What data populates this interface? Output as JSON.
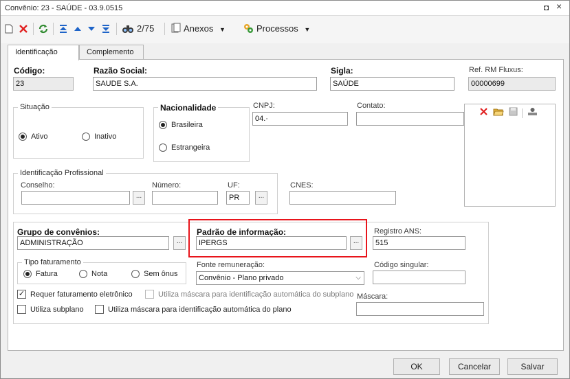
{
  "window": {
    "title": "Convênio: 23 - SAÚDE - 03.9.0515",
    "restore_glyph": "◘",
    "close_glyph": "×"
  },
  "toolbar": {
    "record_position": "2/75",
    "anexos_label": "Anexos",
    "processos_label": "Processos",
    "icons": [
      "new-icon",
      "delete-icon",
      "refresh-icon",
      "first-icon",
      "previous-icon",
      "next-icon",
      "last-icon",
      "find-icon",
      "attachments-icon",
      "processes-icon"
    ]
  },
  "tabs": [
    {
      "label": "Identificação",
      "active": true
    },
    {
      "label": "Complemento",
      "active": false
    }
  ],
  "form": {
    "codigo_label": "Código:",
    "codigo_value": "23",
    "razao_social_label": "Razão Social:",
    "razao_social_value": "SAUDE S.A.",
    "sigla_label": "Sigla:",
    "sigla_value": "SAÚDE",
    "ref_rm_label": "Ref. RM Fluxus:",
    "ref_rm_value": "00000699",
    "situacao_label": "Situação",
    "situacao_options": [
      "Ativo",
      "Inativo"
    ],
    "situacao_selected": "Ativo",
    "nacionalidade_label": "Nacionalidade",
    "nacionalidade_options": [
      "Brasileira",
      "Estrangeira"
    ],
    "nacionalidade_selected": "Brasileira",
    "cnpj_label": "CNPJ:",
    "cnpj_value": "04.·",
    "contato_label": "Contato:",
    "contato_value": "",
    "id_prof_label": "Identificação Profissional",
    "conselho_label": "Conselho:",
    "conselho_value": "",
    "numero_label": "Número:",
    "numero_value": "",
    "uf_label": "UF:",
    "uf_value": "PR",
    "cnes_label": "CNES:",
    "cnes_value": "",
    "grupo_label": "Grupo de convênios:",
    "grupo_value": "ADMINISTRAÇÃO",
    "padrao_label": "Padrão de informação:",
    "padrao_value": "IPERGS",
    "registro_ans_label": "Registro ANS:",
    "registro_ans_value": "515",
    "tipo_fat_label": "Tipo faturamento",
    "tipo_fat_options": [
      "Fatura",
      "Nota",
      "Sem ônus"
    ],
    "tipo_fat_selected": "Fatura",
    "fonte_label": "Fonte remuneração:",
    "fonte_value": "Convênio - Plano privado",
    "codigo_singular_label": "Código singular:",
    "codigo_singular_value": "",
    "req_fat_label": "Requer faturamento eletrônico",
    "req_fat_checked": true,
    "mascara_subplano_label": "Utiliza máscara para identificação automática do subplano",
    "mascara_label": "Máscara:",
    "mascara_value": "",
    "utiliza_subplano_label": "Utiliza subplano",
    "mascara_plano_label": "Utiliza máscara para identificação automática do plano",
    "dots": "..."
  },
  "footer": {
    "ok_label": "OK",
    "cancel_label": "Cancelar",
    "save_label": "Salvar"
  },
  "colors": {
    "highlight": "#e8141b",
    "accent": "#1e64c8"
  }
}
